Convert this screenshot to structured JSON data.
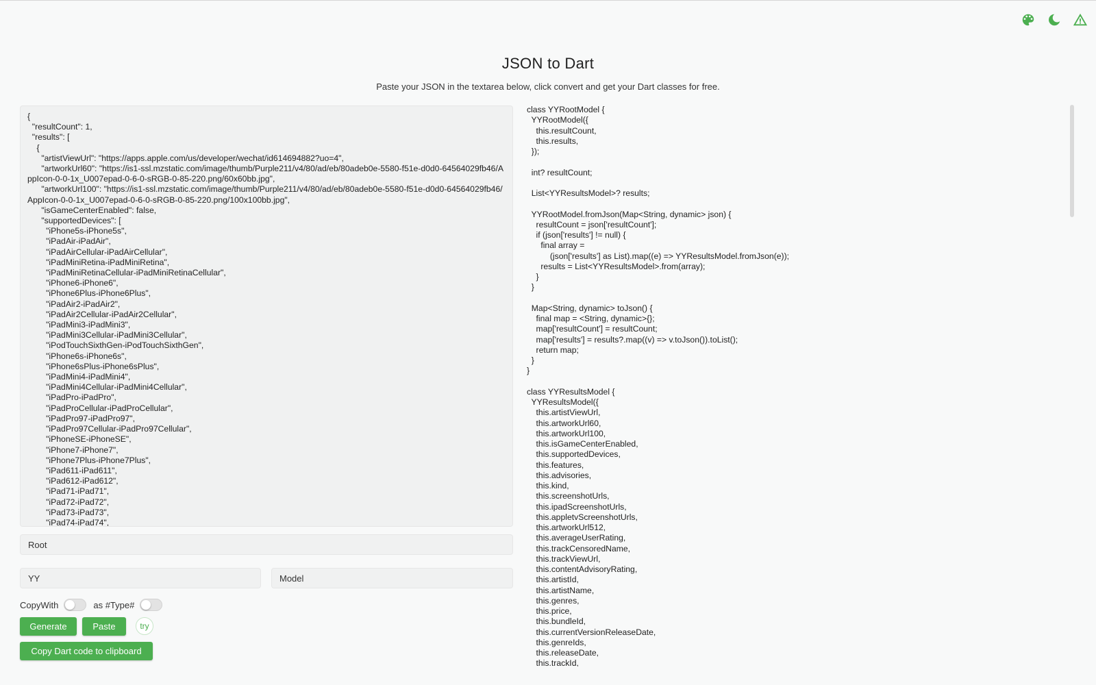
{
  "header": {
    "title": "JSON to Dart",
    "subtitle": "Paste your JSON in the textarea below, click convert and get your Dart classes for free."
  },
  "icons": {
    "theme": "palette-icon",
    "dark_mode": "moon-icon",
    "issue": "warning-icon"
  },
  "colors": {
    "accent": "#4caf50"
  },
  "json_input": {
    "value": "{\n  \"resultCount\": 1,\n  \"results\": [\n    {\n      \"artistViewUrl\": \"https://apps.apple.com/us/developer/wechat/id614694882?uo=4\",\n      \"artworkUrl60\": \"https://is1-ssl.mzstatic.com/image/thumb/Purple211/v4/80/ad/eb/80adeb0e-5580-f51e-d0d0-64564029fb46/AppIcon-0-0-1x_U007epad-0-6-0-sRGB-0-85-220.png/60x60bb.jpg\",\n      \"artworkUrl100\": \"https://is1-ssl.mzstatic.com/image/thumb/Purple211/v4/80/ad/eb/80adeb0e-5580-f51e-d0d0-64564029fb46/AppIcon-0-0-1x_U007epad-0-6-0-sRGB-0-85-220.png/100x100bb.jpg\",\n      \"isGameCenterEnabled\": false,\n      \"supportedDevices\": [\n        \"iPhone5s-iPhone5s\",\n        \"iPadAir-iPadAir\",\n        \"iPadAirCellular-iPadAirCellular\",\n        \"iPadMiniRetina-iPadMiniRetina\",\n        \"iPadMiniRetinaCellular-iPadMiniRetinaCellular\",\n        \"iPhone6-iPhone6\",\n        \"iPhone6Plus-iPhone6Plus\",\n        \"iPadAir2-iPadAir2\",\n        \"iPadAir2Cellular-iPadAir2Cellular\",\n        \"iPadMini3-iPadMini3\",\n        \"iPadMini3Cellular-iPadMini3Cellular\",\n        \"iPodTouchSixthGen-iPodTouchSixthGen\",\n        \"iPhone6s-iPhone6s\",\n        \"iPhone6sPlus-iPhone6sPlus\",\n        \"iPadMini4-iPadMini4\",\n        \"iPadMini4Cellular-iPadMini4Cellular\",\n        \"iPadPro-iPadPro\",\n        \"iPadProCellular-iPadProCellular\",\n        \"iPadPro97-iPadPro97\",\n        \"iPadPro97Cellular-iPadPro97Cellular\",\n        \"iPhoneSE-iPhoneSE\",\n        \"iPhone7-iPhone7\",\n        \"iPhone7Plus-iPhone7Plus\",\n        \"iPad611-iPad611\",\n        \"iPad612-iPad612\",\n        \"iPad71-iPad71\",\n        \"iPad72-iPad72\",\n        \"iPad73-iPad73\",\n        \"iPad74-iPad74\","
  },
  "fields": {
    "root_class": "Root",
    "prefix": "YY",
    "suffix": "Model"
  },
  "options": {
    "copywith_label": "CopyWith",
    "type_label": "as #Type#"
  },
  "buttons": {
    "generate": "Generate",
    "paste": "Paste",
    "try": "try",
    "copy": "Copy Dart code to clipboard"
  },
  "dart_output": {
    "code": "class YYRootModel {\n  YYRootModel({\n    this.resultCount,\n    this.results,\n  });\n\n  int? resultCount;\n\n  List<YYResultsModel>? results;\n\n  YYRootModel.fromJson(Map<String, dynamic> json) {\n    resultCount = json['resultCount'];\n    if (json['results'] != null) {\n      final array =\n          (json['results'] as List).map((e) => YYResultsModel.fromJson(e));\n      results = List<YYResultsModel>.from(array);\n    }\n  }\n\n  Map<String, dynamic> toJson() {\n    final map = <String, dynamic>{};\n    map['resultCount'] = resultCount;\n    map['results'] = results?.map((v) => v.toJson()).toList();\n    return map;\n  }\n}\n\nclass YYResultsModel {\n  YYResultsModel({\n    this.artistViewUrl,\n    this.artworkUrl60,\n    this.artworkUrl100,\n    this.isGameCenterEnabled,\n    this.supportedDevices,\n    this.features,\n    this.advisories,\n    this.kind,\n    this.screenshotUrls,\n    this.ipadScreenshotUrls,\n    this.appletvScreenshotUrls,\n    this.artworkUrl512,\n    this.averageUserRating,\n    this.trackCensoredName,\n    this.trackViewUrl,\n    this.contentAdvisoryRating,\n    this.artistId,\n    this.artistName,\n    this.genres,\n    this.price,\n    this.bundleId,\n    this.currentVersionReleaseDate,\n    this.genreIds,\n    this.releaseDate,\n    this.trackId,"
  }
}
